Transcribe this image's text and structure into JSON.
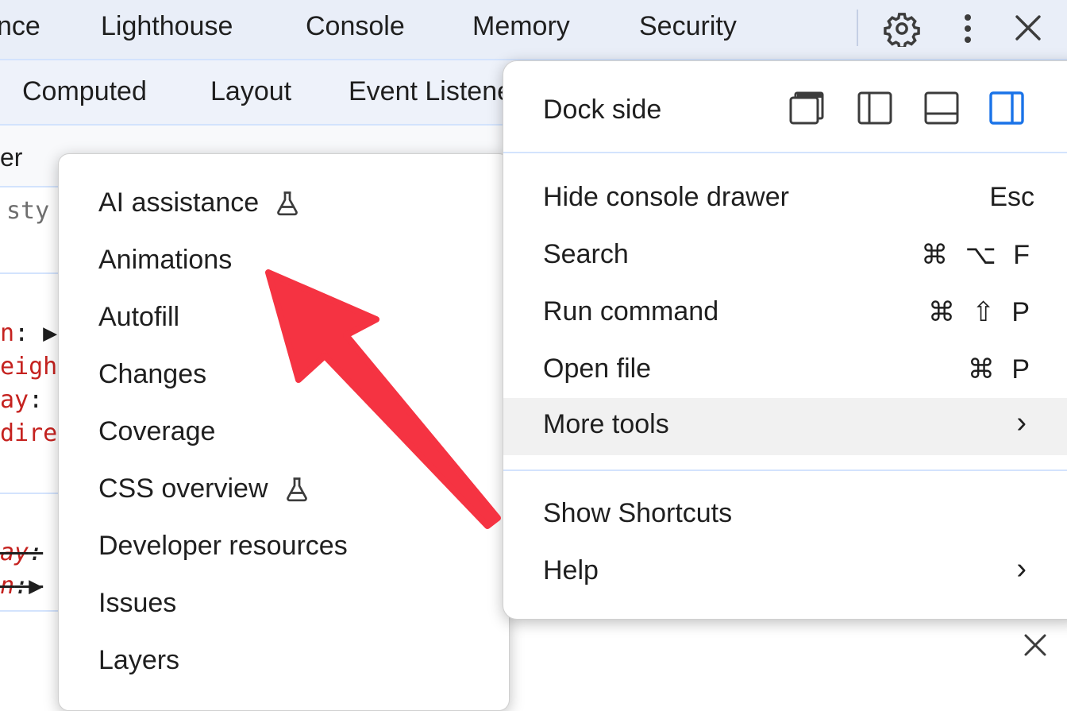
{
  "tabs": [
    {
      "label": "nce"
    },
    {
      "label": "Lighthouse"
    },
    {
      "label": "Console"
    },
    {
      "label": "Memory"
    },
    {
      "label": "Security"
    }
  ],
  "toolbar": {
    "settings_icon": "gear-icon",
    "more_icon": "vertical-dots-icon",
    "close_icon": "close-icon"
  },
  "subtabs": [
    {
      "label": "Computed"
    },
    {
      "label": "Layout"
    },
    {
      "label": "Event Listeners"
    }
  ],
  "styles_pane": {
    "filter_label": "er",
    "filter_placeholder": "sty",
    "lines": [
      {
        "prop": "n",
        "sep": ": ▶"
      },
      {
        "prop": "eigh",
        "sep": ""
      },
      {
        "prop": "ay",
        "sep": ":"
      },
      {
        "prop": "dire",
        "sep": ""
      },
      {
        "prop": "ay",
        "sep": ":"
      },
      {
        "prop": "n",
        "sep": ":▶"
      }
    ]
  },
  "more_tools_menu": {
    "items": [
      {
        "label": "AI assistance",
        "experimental": true
      },
      {
        "label": "Animations",
        "experimental": false
      },
      {
        "label": "Autofill",
        "experimental": false
      },
      {
        "label": "Changes",
        "experimental": false
      },
      {
        "label": "Coverage",
        "experimental": false
      },
      {
        "label": "CSS overview",
        "experimental": true
      },
      {
        "label": "Developer resources",
        "experimental": false
      },
      {
        "label": "Issues",
        "experimental": false
      },
      {
        "label": "Layers",
        "experimental": false
      }
    ]
  },
  "main_menu": {
    "dock_side_label": "Dock side",
    "dock_options": [
      "undock-icon",
      "dock-left-icon",
      "dock-bottom-icon",
      "dock-right-icon"
    ],
    "dock_selected": "dock-right-icon",
    "items": [
      {
        "label": "Hide console drawer",
        "shortcut": "Esc"
      },
      {
        "label": "Search",
        "shortcut": "⌘ ⌥ F"
      },
      {
        "label": "Run command",
        "shortcut": "⌘ ⇧ P"
      },
      {
        "label": "Open file",
        "shortcut": "⌘ P"
      },
      {
        "label": "More tools",
        "shortcut": "›"
      },
      {
        "label": "Show Shortcuts",
        "shortcut": ""
      },
      {
        "label": "Help",
        "shortcut": "›"
      }
    ]
  },
  "colors": {
    "accent": "#1a73e8",
    "arrow": "#f53342",
    "tabbar_bg": "#e9eef8",
    "highlight": "#f1f1f1"
  }
}
